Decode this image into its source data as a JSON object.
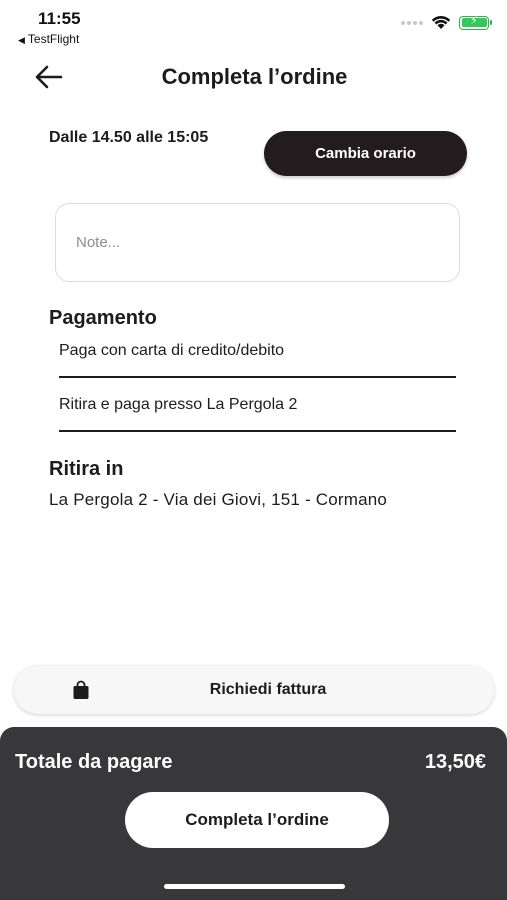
{
  "status_bar": {
    "time": "11:55",
    "back_app": "TestFlight",
    "battery_color": "#34c759"
  },
  "header": {
    "title": "Completa l’ordine",
    "back_icon": "arrow-left-icon"
  },
  "pickup_time": {
    "range": "Dalle 14.50 alle 15:05",
    "change_label": "Cambia orario"
  },
  "notes": {
    "placeholder": "Note...",
    "value": ""
  },
  "payment": {
    "title": "Pagamento",
    "options": [
      "Paga con carta di credito/debito",
      "Ritira e paga presso La Pergola 2"
    ]
  },
  "pickup": {
    "title": "Ritira in",
    "address": "La Pergola 2 - Via dei Giovi, 151 - Cormano"
  },
  "invoice": {
    "label": "Richiedi fattura",
    "icon": "shopping-bag-icon"
  },
  "footer": {
    "total_label": "Totale da pagare",
    "total_value": "13,50€",
    "complete_label": "Completa l’ordine",
    "panel_color": "#38383a"
  }
}
